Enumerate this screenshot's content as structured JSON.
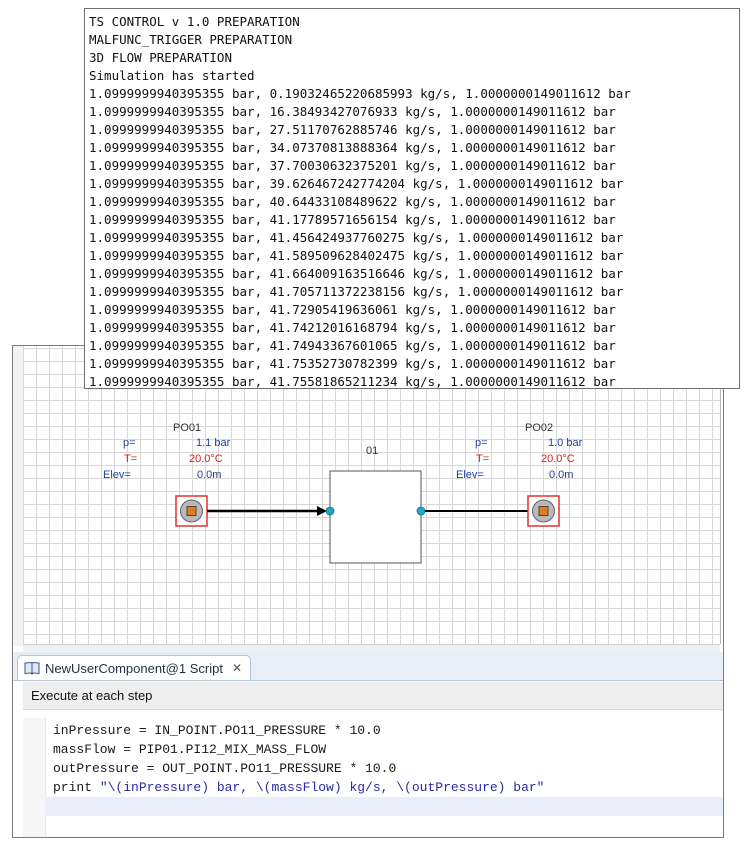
{
  "console": {
    "lines": [
      "TS CONTROL v 1.0 PREPARATION",
      "MALFUNC_TRIGGER PREPARATION",
      "3D FLOW PREPARATION",
      "Simulation has started",
      "1.0999999940395355 bar, 0.19032465220685993 kg/s, 1.0000000149011612 bar",
      "1.0999999940395355 bar, 16.38493427076933 kg/s, 1.0000000149011612 bar",
      "1.0999999940395355 bar, 27.51170762885746 kg/s, 1.0000000149011612 bar",
      "1.0999999940395355 bar, 34.07370813888364 kg/s, 1.0000000149011612 bar",
      "1.0999999940395355 bar, 37.70030632375201 kg/s, 1.0000000149011612 bar",
      "1.0999999940395355 bar, 39.626467242774204 kg/s, 1.0000000149011612 bar",
      "1.0999999940395355 bar, 40.64433108489622 kg/s, 1.0000000149011612 bar",
      "1.0999999940395355 bar, 41.17789571656154 kg/s, 1.0000000149011612 bar",
      "1.0999999940395355 bar, 41.456424937760275 kg/s, 1.0000000149011612 bar",
      "1.0999999940395355 bar, 41.589509628402475 kg/s, 1.0000000149011612 bar",
      "1.0999999940395355 bar, 41.664009163516646 kg/s, 1.0000000149011612 bar",
      "1.0999999940395355 bar, 41.705711372238156 kg/s, 1.0000000149011612 bar",
      "1.0999999940395355 bar, 41.72905419636061 kg/s, 1.0000000149011612 bar",
      "1.0999999940395355 bar, 41.74212016168794 kg/s, 1.0000000149011612 bar",
      "1.0999999940395355 bar, 41.74943367601065 kg/s, 1.0000000149011612 bar",
      "1.0999999940395355 bar, 41.75352730782399 kg/s, 1.0000000149011612 bar",
      "1.0999999940395355 bar, 41.75581865211234 kg/s, 1.0000000149011612 bar"
    ]
  },
  "diagram": {
    "po01": {
      "name": "PO01",
      "p_label": "p=",
      "p_value": "1.1 bar",
      "t_label": "T=",
      "t_value": "20.0°C",
      "elev_label": "Elev=",
      "elev_value": "0.0m"
    },
    "po02": {
      "name": "PO02",
      "p_label": "p=",
      "p_value": "1.0 bar",
      "t_label": "T=",
      "t_value": "20.0°C",
      "elev_label": "Elev=",
      "elev_value": "0.0m"
    },
    "component": {
      "name": "01"
    },
    "colors": {
      "param_label": "#1f3f9f",
      "temperature": "#d42020",
      "port_node": "#22a5c8",
      "point_frame": "#e23030",
      "point_fill": "#e07a2a"
    }
  },
  "script": {
    "tab_title": "NewUserComponent@1 Script",
    "tab_icon": "book-icon",
    "close_icon": "close-icon",
    "execute_label": "Execute at each step",
    "code": {
      "line1": "inPressure = IN_POINT.PO11_PRESSURE * 10.0",
      "line2": "massFlow = PIP01.PI12_MIX_MASS_FLOW",
      "line3": "outPressure = OUT_POINT.PO11_PRESSURE * 10.0",
      "line4_keyword": "print ",
      "line4_string": "\"\\(inPressure) bar, \\(massFlow) kg/s, \\(outPressure) bar\""
    }
  }
}
